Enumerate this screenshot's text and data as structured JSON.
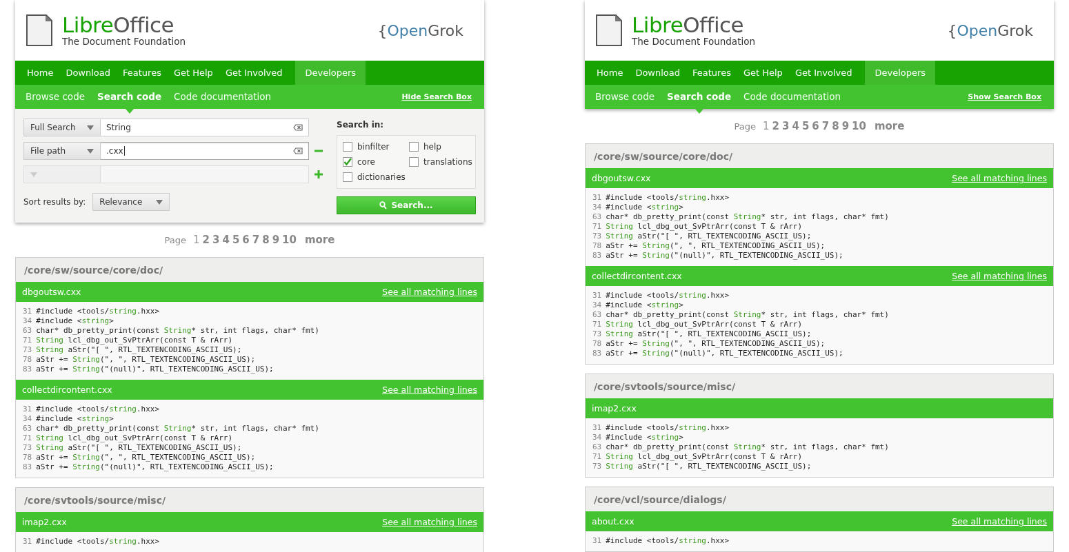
{
  "panels": [
    {
      "header": {
        "wordmark": [
          {
            "text": "Libre",
            "kind": "accent"
          },
          {
            "text": "Office",
            "kind": "plain"
          }
        ],
        "tagline": "The Document Foundation",
        "brand": [
          {
            "text": "{",
            "kind": "plain"
          },
          {
            "text": "Open",
            "kind": "blue"
          },
          {
            "text": "Grok",
            "kind": "plain"
          }
        ]
      },
      "nav": [
        {
          "label": "Home",
          "selected": false
        },
        {
          "label": "Download",
          "selected": false
        },
        {
          "label": "Features",
          "selected": false
        },
        {
          "label": "Get Help",
          "selected": false
        },
        {
          "label": "Get Involved",
          "selected": false
        },
        {
          "label": "Developers",
          "selected": true
        }
      ],
      "subnav": [
        {
          "label": "Browse code",
          "selected": false
        },
        {
          "label": "Search code",
          "selected": true
        },
        {
          "label": "Code documentation",
          "selected": false
        }
      ],
      "toggle_link": "Hide Search Box",
      "search_form": {
        "rows": [
          {
            "type": "Full Search",
            "value": "String",
            "focused": false,
            "disabled": false
          },
          {
            "type": "File path",
            "value": ".cxx",
            "focused": true,
            "disabled": false,
            "kind": "remove"
          },
          {
            "focused": false,
            "disabled": true,
            "kind": "add"
          }
        ],
        "sort_label": "Sort results by:",
        "sort_value": "Relevance",
        "search_in_label": "Search in:",
        "projects": [
          {
            "label": "binfilter",
            "checked": false
          },
          {
            "label": "core",
            "checked": true
          },
          {
            "label": "dictionaries",
            "checked": false
          },
          {
            "label": "help",
            "checked": false
          },
          {
            "label": "translations",
            "checked": false
          }
        ],
        "search_button": "Search..."
      },
      "pagination": {
        "label": "Page",
        "pages": [
          {
            "label": "1",
            "selected": true
          },
          {
            "label": "2",
            "selected": false
          },
          {
            "label": "3",
            "selected": false
          },
          {
            "label": "4",
            "selected": false
          },
          {
            "label": "5",
            "selected": false
          },
          {
            "label": "6",
            "selected": false
          },
          {
            "label": "7",
            "selected": false
          },
          {
            "label": "8",
            "selected": false
          },
          {
            "label": "9",
            "selected": false
          },
          {
            "label": "10",
            "selected": false
          }
        ],
        "more": "more"
      },
      "results": [
        {
          "path": "/core/sw/source/core/doc/",
          "files": [
            {
              "name": "dbgoutsw.cxx",
              "link": "See all matching lines",
              "lines": [
                {
                  "num": "31",
                  "segments": [
                    {
                      "text": "#include <tools/",
                      "match": false
                    },
                    {
                      "text": "string",
                      "match": true
                    },
                    {
                      "text": ".hxx>",
                      "match": false
                    }
                  ]
                },
                {
                  "num": "34",
                  "segments": [
                    {
                      "text": "#include <",
                      "match": false
                    },
                    {
                      "text": "string",
                      "match": true
                    },
                    {
                      "text": ">",
                      "match": false
                    }
                  ]
                },
                {
                  "num": "63",
                  "segments": [
                    {
                      "text": "char* db_pretty_print(const ",
                      "match": false
                    },
                    {
                      "text": "String",
                      "match": true
                    },
                    {
                      "text": "* str, int flags, char* fmt)",
                      "match": false
                    }
                  ]
                },
                {
                  "num": "71",
                  "segments": [
                    {
                      "text": "String",
                      "match": true
                    },
                    {
                      "text": " lcl_dbg_out_SvPtrArr(const T & rArr)",
                      "match": false
                    }
                  ]
                },
                {
                  "num": "73",
                  "segments": [
                    {
                      "text": "String",
                      "match": true
                    },
                    {
                      "text": " aStr(\"[ \", RTL_TEXTENCODING_ASCII_US);",
                      "match": false
                    }
                  ]
                },
                {
                  "num": "78",
                  "segments": [
                    {
                      "text": "aStr += ",
                      "match": false
                    },
                    {
                      "text": "String",
                      "match": true
                    },
                    {
                      "text": "(\", \", RTL_TEXTENCODING_ASCII_US);",
                      "match": false
                    }
                  ]
                },
                {
                  "num": "83",
                  "segments": [
                    {
                      "text": "aStr += ",
                      "match": false
                    },
                    {
                      "text": "String",
                      "match": true
                    },
                    {
                      "text": "(\"(null)\", RTL_TEXTENCODING_ASCII_US);",
                      "match": false
                    }
                  ]
                }
              ]
            },
            {
              "name": "collectdircontent.cxx",
              "link": "See all matching lines",
              "lines": [
                {
                  "num": "31",
                  "segments": [
                    {
                      "text": "#include <tools/",
                      "match": false
                    },
                    {
                      "text": "string",
                      "match": true
                    },
                    {
                      "text": ".hxx>",
                      "match": false
                    }
                  ]
                },
                {
                  "num": "34",
                  "segments": [
                    {
                      "text": "#include <",
                      "match": false
                    },
                    {
                      "text": "string",
                      "match": true
                    },
                    {
                      "text": ">",
                      "match": false
                    }
                  ]
                },
                {
                  "num": "63",
                  "segments": [
                    {
                      "text": "char* db_pretty_print(const ",
                      "match": false
                    },
                    {
                      "text": "String",
                      "match": true
                    },
                    {
                      "text": "* str, int flags, char* fmt)",
                      "match": false
                    }
                  ]
                },
                {
                  "num": "71",
                  "segments": [
                    {
                      "text": "String",
                      "match": true
                    },
                    {
                      "text": " lcl_dbg_out_SvPtrArr(const T & rArr)",
                      "match": false
                    }
                  ]
                },
                {
                  "num": "73",
                  "segments": [
                    {
                      "text": "String",
                      "match": true
                    },
                    {
                      "text": " aStr(\"[ \", RTL_TEXTENCODING_ASCII_US);",
                      "match": false
                    }
                  ]
                },
                {
                  "num": "78",
                  "segments": [
                    {
                      "text": "aStr += ",
                      "match": false
                    },
                    {
                      "text": "String",
                      "match": true
                    },
                    {
                      "text": "(\", \", RTL_TEXTENCODING_ASCII_US);",
                      "match": false
                    }
                  ]
                },
                {
                  "num": "83",
                  "segments": [
                    {
                      "text": "aStr += ",
                      "match": false
                    },
                    {
                      "text": "String",
                      "match": true
                    },
                    {
                      "text": "(\"(null)\", RTL_TEXTENCODING_ASCII_US);",
                      "match": false
                    }
                  ]
                }
              ]
            }
          ]
        },
        {
          "path": "/core/svtools/source/misc/",
          "files": [
            {
              "name": "imap2.cxx",
              "link": "See all matching lines",
              "lines": [
                {
                  "num": "31",
                  "segments": [
                    {
                      "text": "#include <tools/",
                      "match": false
                    },
                    {
                      "text": "string",
                      "match": true
                    },
                    {
                      "text": ".hxx>",
                      "match": false
                    }
                  ]
                }
              ]
            }
          ]
        }
      ]
    },
    {
      "header": {
        "wordmark": [
          {
            "text": "Libre",
            "kind": "accent"
          },
          {
            "text": "Office",
            "kind": "plain"
          }
        ],
        "tagline": "The Document Foundation",
        "brand": [
          {
            "text": "{",
            "kind": "plain"
          },
          {
            "text": "Open",
            "kind": "blue"
          },
          {
            "text": "Grok",
            "kind": "plain"
          }
        ]
      },
      "nav": [
        {
          "label": "Home",
          "selected": false
        },
        {
          "label": "Download",
          "selected": false
        },
        {
          "label": "Features",
          "selected": false
        },
        {
          "label": "Get Help",
          "selected": false
        },
        {
          "label": "Get Involved",
          "selected": false
        },
        {
          "label": "Developers",
          "selected": true
        }
      ],
      "subnav": [
        {
          "label": "Browse code",
          "selected": false
        },
        {
          "label": "Search code",
          "selected": true
        },
        {
          "label": "Code documentation",
          "selected": false
        }
      ],
      "toggle_link": "Show Search Box",
      "pagination": {
        "label": "Page",
        "pages": [
          {
            "label": "1",
            "selected": true
          },
          {
            "label": "2",
            "selected": false
          },
          {
            "label": "3",
            "selected": false
          },
          {
            "label": "4",
            "selected": false
          },
          {
            "label": "5",
            "selected": false
          },
          {
            "label": "6",
            "selected": false
          },
          {
            "label": "7",
            "selected": false
          },
          {
            "label": "8",
            "selected": false
          },
          {
            "label": "9",
            "selected": false
          },
          {
            "label": "10",
            "selected": false
          }
        ],
        "more": "more"
      },
      "results": [
        {
          "path": "/core/sw/source/core/doc/",
          "files": [
            {
              "name": "dbgoutsw.cxx",
              "link": "See all matching lines",
              "lines": [
                {
                  "num": "31",
                  "segments": [
                    {
                      "text": "#include <tools/",
                      "match": false
                    },
                    {
                      "text": "string",
                      "match": true
                    },
                    {
                      "text": ".hxx>",
                      "match": false
                    }
                  ]
                },
                {
                  "num": "34",
                  "segments": [
                    {
                      "text": "#include <",
                      "match": false
                    },
                    {
                      "text": "string",
                      "match": true
                    },
                    {
                      "text": ">",
                      "match": false
                    }
                  ]
                },
                {
                  "num": "63",
                  "segments": [
                    {
                      "text": "char* db_pretty_print(const ",
                      "match": false
                    },
                    {
                      "text": "String",
                      "match": true
                    },
                    {
                      "text": "* str, int flags, char* fmt)",
                      "match": false
                    }
                  ]
                },
                {
                  "num": "71",
                  "segments": [
                    {
                      "text": "String",
                      "match": true
                    },
                    {
                      "text": " lcl_dbg_out_SvPtrArr(const T & rArr)",
                      "match": false
                    }
                  ]
                },
                {
                  "num": "73",
                  "segments": [
                    {
                      "text": "String",
                      "match": true
                    },
                    {
                      "text": " aStr(\"[ \", RTL_TEXTENCODING_ASCII_US);",
                      "match": false
                    }
                  ]
                },
                {
                  "num": "78",
                  "segments": [
                    {
                      "text": "aStr += ",
                      "match": false
                    },
                    {
                      "text": "String",
                      "match": true
                    },
                    {
                      "text": "(\", \", RTL_TEXTENCODING_ASCII_US);",
                      "match": false
                    }
                  ]
                },
                {
                  "num": "83",
                  "segments": [
                    {
                      "text": "aStr += ",
                      "match": false
                    },
                    {
                      "text": "String",
                      "match": true
                    },
                    {
                      "text": "(\"(null)\", RTL_TEXTENCODING_ASCII_US);",
                      "match": false
                    }
                  ]
                }
              ]
            },
            {
              "name": "collectdircontent.cxx",
              "link": "See all matching lines",
              "lines": [
                {
                  "num": "31",
                  "segments": [
                    {
                      "text": "#include <tools/",
                      "match": false
                    },
                    {
                      "text": "string",
                      "match": true
                    },
                    {
                      "text": ".hxx>",
                      "match": false
                    }
                  ]
                },
                {
                  "num": "34",
                  "segments": [
                    {
                      "text": "#include <",
                      "match": false
                    },
                    {
                      "text": "string",
                      "match": true
                    },
                    {
                      "text": ">",
                      "match": false
                    }
                  ]
                },
                {
                  "num": "63",
                  "segments": [
                    {
                      "text": "char* db_pretty_print(const ",
                      "match": false
                    },
                    {
                      "text": "String",
                      "match": true
                    },
                    {
                      "text": "* str, int flags, char* fmt)",
                      "match": false
                    }
                  ]
                },
                {
                  "num": "71",
                  "segments": [
                    {
                      "text": "String",
                      "match": true
                    },
                    {
                      "text": " lcl_dbg_out_SvPtrArr(const T & rArr)",
                      "match": false
                    }
                  ]
                },
                {
                  "num": "73",
                  "segments": [
                    {
                      "text": "String",
                      "match": true
                    },
                    {
                      "text": " aStr(\"[ \", RTL_TEXTENCODING_ASCII_US);",
                      "match": false
                    }
                  ]
                },
                {
                  "num": "78",
                  "segments": [
                    {
                      "text": "aStr += ",
                      "match": false
                    },
                    {
                      "text": "String",
                      "match": true
                    },
                    {
                      "text": "(\", \", RTL_TEXTENCODING_ASCII_US);",
                      "match": false
                    }
                  ]
                },
                {
                  "num": "83",
                  "segments": [
                    {
                      "text": "aStr += ",
                      "match": false
                    },
                    {
                      "text": "String",
                      "match": true
                    },
                    {
                      "text": "(\"(null)\", RTL_TEXTENCODING_ASCII_US);",
                      "match": false
                    }
                  ]
                }
              ]
            }
          ]
        },
        {
          "path": "/core/svtools/source/misc/",
          "files": [
            {
              "name": "imap2.cxx",
              "lines": [
                {
                  "num": "31",
                  "segments": [
                    {
                      "text": "#include <tools/",
                      "match": false
                    },
                    {
                      "text": "string",
                      "match": true
                    },
                    {
                      "text": ".hxx>",
                      "match": false
                    }
                  ]
                },
                {
                  "num": "34",
                  "segments": [
                    {
                      "text": "#include <",
                      "match": false
                    },
                    {
                      "text": "string",
                      "match": true
                    },
                    {
                      "text": ">",
                      "match": false
                    }
                  ]
                },
                {
                  "num": "63",
                  "segments": [
                    {
                      "text": "char* db_pretty_print(const ",
                      "match": false
                    },
                    {
                      "text": "String",
                      "match": true
                    },
                    {
                      "text": "* str, int flags, char* fmt)",
                      "match": false
                    }
                  ]
                },
                {
                  "num": "71",
                  "segments": [
                    {
                      "text": "String",
                      "match": true
                    },
                    {
                      "text": " lcl_dbg_out_SvPtrArr(const T & rArr)",
                      "match": false
                    }
                  ]
                },
                {
                  "num": "73",
                  "segments": [
                    {
                      "text": "String",
                      "match": true
                    },
                    {
                      "text": " aStr(\"[ \", RTL_TEXTENCODING_ASCII_US);",
                      "match": false
                    }
                  ]
                }
              ]
            }
          ]
        },
        {
          "path": "/core/vcl/source/dialogs/",
          "files": [
            {
              "name": "about.cxx",
              "link": "See all matching lines",
              "lines": [
                {
                  "num": "31",
                  "segments": [
                    {
                      "text": "#include <tools/",
                      "match": false
                    },
                    {
                      "text": "string",
                      "match": true
                    },
                    {
                      "text": ".hxx>",
                      "match": false
                    }
                  ]
                }
              ]
            }
          ]
        }
      ]
    }
  ]
}
